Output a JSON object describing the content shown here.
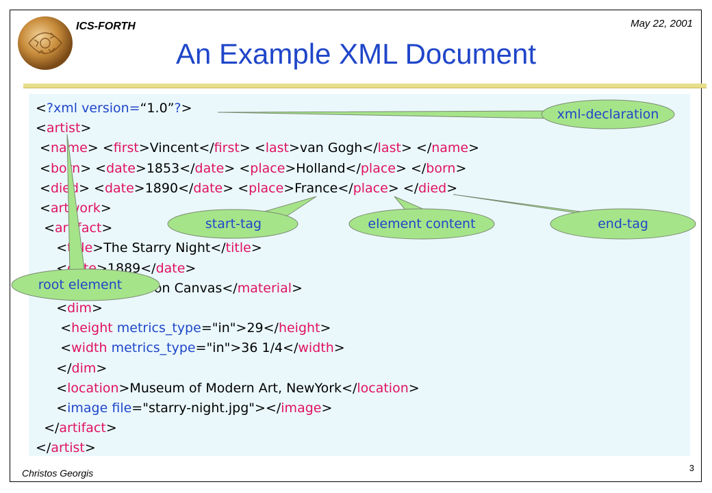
{
  "header": {
    "org": "ICS-FORTH",
    "date": "May 22, 2001"
  },
  "slide_title": "An Example XML Document",
  "code_lines": [
    [
      [
        "b",
        "<"
      ],
      [
        "a",
        "?xml version="
      ],
      [
        "b",
        "“1.0”"
      ],
      [
        "a",
        "?"
      ],
      [
        "b",
        ">"
      ]
    ],
    [
      [
        "b",
        "<"
      ],
      [
        "t",
        "artist"
      ],
      [
        "b",
        ">"
      ]
    ],
    [
      [
        "b",
        " <"
      ],
      [
        "t",
        "name"
      ],
      [
        "b",
        "> <"
      ],
      [
        "t",
        "first"
      ],
      [
        "b",
        ">Vincent</"
      ],
      [
        "t",
        "first"
      ],
      [
        "b",
        "> <"
      ],
      [
        "t",
        "last"
      ],
      [
        "b",
        ">van Gogh</"
      ],
      [
        "t",
        "last"
      ],
      [
        "b",
        "> </"
      ],
      [
        "t",
        "name"
      ],
      [
        "b",
        ">"
      ]
    ],
    [
      [
        "b",
        " <"
      ],
      [
        "t",
        "born"
      ],
      [
        "b",
        "> <"
      ],
      [
        "t",
        "date"
      ],
      [
        "b",
        ">1853</"
      ],
      [
        "t",
        "date"
      ],
      [
        "b",
        "> <"
      ],
      [
        "t",
        "place"
      ],
      [
        "b",
        ">Holland</"
      ],
      [
        "t",
        "place"
      ],
      [
        "b",
        "> </"
      ],
      [
        "t",
        "born"
      ],
      [
        "b",
        ">"
      ]
    ],
    [
      [
        "b",
        " <"
      ],
      [
        "t",
        "died"
      ],
      [
        "b",
        "> <"
      ],
      [
        "t",
        "date"
      ],
      [
        "b",
        ">1890</"
      ],
      [
        "t",
        "date"
      ],
      [
        "b",
        "> <"
      ],
      [
        "t",
        "place"
      ],
      [
        "b",
        ">France</"
      ],
      [
        "t",
        "place"
      ],
      [
        "b",
        "> </"
      ],
      [
        "t",
        "died"
      ],
      [
        "b",
        ">"
      ]
    ],
    [
      [
        "b",
        " <"
      ],
      [
        "t",
        "artwork"
      ],
      [
        "b",
        ">"
      ]
    ],
    [
      [
        "b",
        "  <"
      ],
      [
        "t",
        "artifact"
      ],
      [
        "b",
        ">"
      ]
    ],
    [
      [
        "b",
        "     <"
      ],
      [
        "t",
        "title"
      ],
      [
        "b",
        ">The Starry Night</"
      ],
      [
        "t",
        "title"
      ],
      [
        "b",
        ">"
      ]
    ],
    [
      [
        "b",
        "     <"
      ],
      [
        "t",
        "date"
      ],
      [
        "b",
        ">1889</"
      ],
      [
        "t",
        "date"
      ],
      [
        "b",
        ">"
      ]
    ],
    [
      [
        "b",
        "     <"
      ],
      [
        "t",
        "material"
      ],
      [
        "b",
        ">Oil on Canvas</"
      ],
      [
        "t",
        "material"
      ],
      [
        "b",
        ">"
      ]
    ],
    [
      [
        "b",
        "     <"
      ],
      [
        "t",
        "dim"
      ],
      [
        "b",
        ">"
      ]
    ],
    [
      [
        "b",
        "      <"
      ],
      [
        "t",
        "height"
      ],
      [
        "b",
        " "
      ],
      [
        "a",
        "metrics_type"
      ],
      [
        "b",
        "=\"in\">29</"
      ],
      [
        "t",
        "height"
      ],
      [
        "b",
        ">"
      ]
    ],
    [
      [
        "b",
        "      <"
      ],
      [
        "t",
        "width"
      ],
      [
        "b",
        " "
      ],
      [
        "a",
        "metrics_type"
      ],
      [
        "b",
        "=\"in\">36 1/4</"
      ],
      [
        "t",
        "width"
      ],
      [
        "b",
        ">"
      ]
    ],
    [
      [
        "b",
        "     </"
      ],
      [
        "t",
        "dim"
      ],
      [
        "b",
        ">"
      ]
    ],
    [
      [
        "b",
        "     <"
      ],
      [
        "t",
        "location"
      ],
      [
        "b",
        ">Museum of Modern Art, NewYork</"
      ],
      [
        "t",
        "location"
      ],
      [
        "b",
        ">"
      ]
    ],
    [
      [
        "b",
        "     <"
      ],
      [
        "a",
        "image file"
      ],
      [
        "b",
        "=\"starry-night.jpg\"></"
      ],
      [
        "t",
        "image"
      ],
      [
        "b",
        ">"
      ]
    ],
    [
      [
        "b",
        "  </"
      ],
      [
        "t",
        "artifact"
      ],
      [
        "b",
        ">"
      ]
    ],
    [
      [
        "b",
        "</"
      ],
      [
        "t",
        "artist"
      ],
      [
        "b",
        ">"
      ]
    ]
  ],
  "callouts": {
    "xml_declaration": "xml-declaration",
    "start_tag": "start-tag",
    "element_content": "element content",
    "end_tag": "end-tag",
    "root_element": "root element"
  },
  "footer": {
    "author": "Christos Georgis",
    "page": "3"
  },
  "colors": {
    "title": "#1f46c9",
    "tag": "#e0115f",
    "attr": "#1f46c9",
    "callout_fill": "#a6e48a",
    "code_bg": "#eaf8fc"
  }
}
